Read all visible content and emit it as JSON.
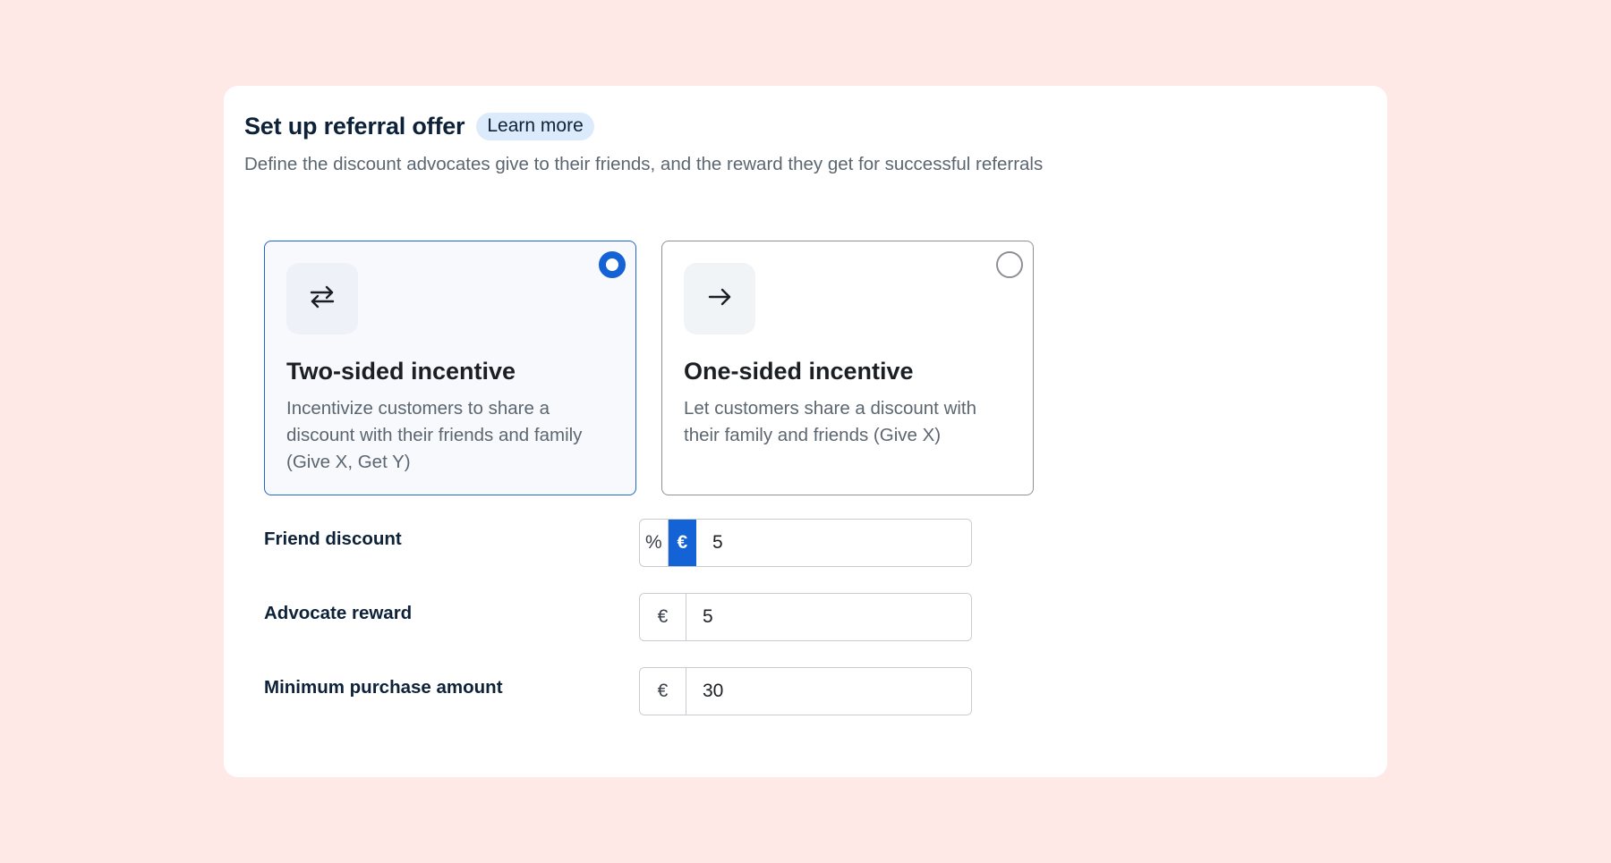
{
  "header": {
    "title": "Set up referral offer",
    "learn_more": "Learn more",
    "subtitle": "Define the discount advocates give to their friends, and the reward they get for successful referrals"
  },
  "options": [
    {
      "title": "Two-sided incentive",
      "description": "Incentivize customers to share a discount with their friends and family (Give X, Get Y)",
      "icon": "swap-arrows-icon",
      "selected": true
    },
    {
      "title": "One-sided incentive",
      "description": "Let customers share a discount with their family and friends (Give X)",
      "icon": "arrow-right-icon",
      "selected": false
    }
  ],
  "fields": {
    "friend_discount": {
      "label": "Friend discount",
      "unit_options": [
        "%",
        "€"
      ],
      "selected_unit": "€",
      "value": "5"
    },
    "advocate_reward": {
      "label": "Advocate reward",
      "prefix": "€",
      "value": "5"
    },
    "minimum_purchase": {
      "label": "Minimum purchase amount",
      "prefix": "€",
      "value": "30"
    }
  },
  "colors": {
    "page_background": "#fee9e7",
    "accent": "#1463d6",
    "selected_border": "#1f66d1",
    "learn_more_bg": "#dcebfb"
  }
}
